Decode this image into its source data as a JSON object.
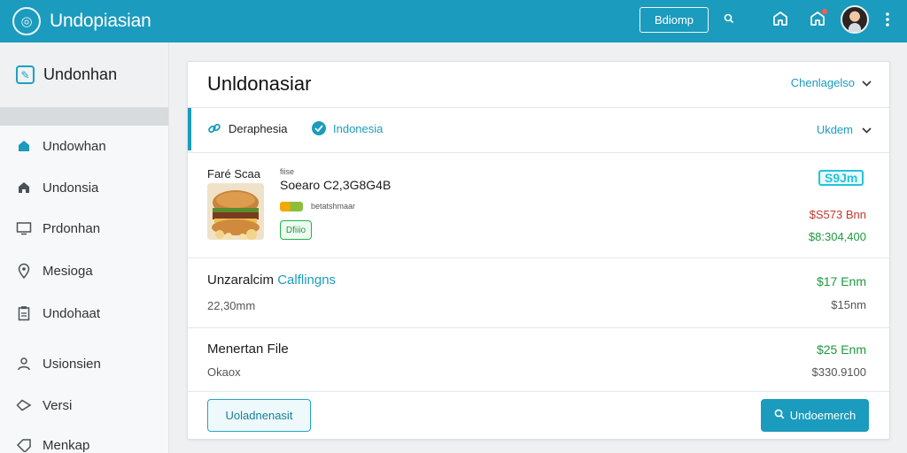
{
  "app": {
    "brand_name": "Undopiasian",
    "top_button_label": "Bdiomp",
    "icons": [
      "globe-logo-icon",
      "search-icon",
      "home-outline-icon",
      "notification-home-icon",
      "more-vert-icon"
    ]
  },
  "sidebar": {
    "title": "Undonhan",
    "items": [
      {
        "label": "Undowhan",
        "icon": "home-icon"
      },
      {
        "label": "Undonsia",
        "icon": "house-icon"
      },
      {
        "label": "Prdonhan",
        "icon": "monitor-icon"
      },
      {
        "label": "Mesioga",
        "icon": "location-pin-icon"
      },
      {
        "label": "Undohaat",
        "icon": "clipboard-icon"
      },
      {
        "label": "Usionsien",
        "icon": "user-icon"
      },
      {
        "label": "Versi",
        "icon": "diamond-icon"
      },
      {
        "label": "Menkap",
        "icon": "tag-icon"
      }
    ]
  },
  "main": {
    "title": "Unldonasiar",
    "header_dropdown": "Chenlagelso",
    "filters": {
      "chip_1": "Deraphesia",
      "chip_2": "Indonesia",
      "dropdown": "Ukdem"
    },
    "rows": [
      {
        "label": "Faré Scaa",
        "small_label": "fiise",
        "name": "Soearo C2,3G8G4B",
        "small_desc": "betatshmaar",
        "tag": "Dfiiio",
        "badge": "S9Jm",
        "price_1": "$S573 Bnn",
        "price_2": "$8:304,400"
      },
      {
        "label": "Unzaralcim",
        "label_accent": "Calflingns",
        "sub": "22,30mm",
        "price_1": "$17 Enm",
        "price_2": "$15nm"
      },
      {
        "label": "Menertan File",
        "sub": "Okaox",
        "price_1": "$25 Enm",
        "price_2": "$330.9100"
      }
    ],
    "footer": {
      "left_button": "Uoladnenasit",
      "right_button": "Undoemerch"
    }
  },
  "colors": {
    "primary": "#1b9bbd",
    "green": "#1c9a3e",
    "red_price": "#c0392b"
  }
}
